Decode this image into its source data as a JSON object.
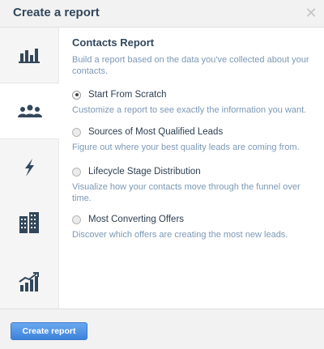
{
  "dialog": {
    "title": "Create a report",
    "close_icon": "close-icon"
  },
  "sidebar": {
    "items": [
      {
        "icon": "bar-chart-icon",
        "active": false
      },
      {
        "icon": "people-icon",
        "active": true
      },
      {
        "icon": "lightning-icon",
        "active": false
      },
      {
        "icon": "building-icon",
        "active": false
      },
      {
        "icon": "trend-chart-icon",
        "active": false
      }
    ]
  },
  "report": {
    "title": "Contacts Report",
    "description": "Build a report based on the data you've collected about your contacts.",
    "options": [
      {
        "label": "Start From Scratch",
        "description": "Customize a report to see exactly the information you want.",
        "selected": true
      },
      {
        "label": "Sources of Most Qualified Leads",
        "description": "Figure out where your best quality leads are coming from.",
        "selected": false
      },
      {
        "label": "Lifecycle Stage Distribution",
        "description": "Visualize how your contacts move through the funnel over time.",
        "selected": false
      },
      {
        "label": "Most Converting Offers",
        "description": "Discover which offers are creating the most new leads.",
        "selected": false
      }
    ]
  },
  "footer": {
    "create_label": "Create report"
  },
  "colors": {
    "icon": "#33475b",
    "accent": "#3d82dc",
    "muted_text": "#7c98b6"
  }
}
